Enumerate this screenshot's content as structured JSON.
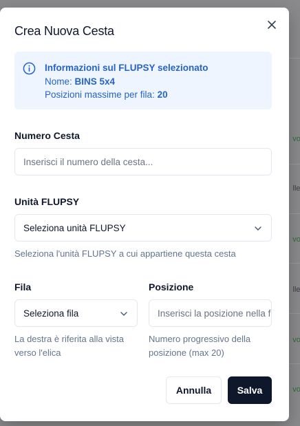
{
  "modal": {
    "title": "Crea Nuova Cesta"
  },
  "info": {
    "heading": "Informazioni sul FLUPSY selezionato",
    "name_label": "Nome: ",
    "name_value": "BINS 5x4",
    "max_label": "Posizioni massime per fila: ",
    "max_value": "20"
  },
  "form": {
    "numero_cesta": {
      "label": "Numero Cesta",
      "placeholder": "Inserisci il numero della cesta...",
      "value": ""
    },
    "unita_flupsy": {
      "label": "Unità FLUPSY",
      "selected": "Seleziona unità FLUPSY",
      "help": "Seleziona l'unità FLUPSY a cui appartiene questa cesta"
    },
    "fila": {
      "label": "Fila",
      "selected": "Seleziona fila",
      "help": "La destra è riferita alla vista verso l'elica"
    },
    "posizione": {
      "label": "Posizione",
      "placeholder": "Inserisci la posizione nella fila",
      "value": "",
      "help": "Numero progressivo della posizione (max 20)"
    }
  },
  "actions": {
    "cancel": "Annulla",
    "save": "Salva"
  },
  "background": {
    "peek_labels": [
      "vo",
      "lle",
      "vo",
      "lle",
      "vo",
      "vo"
    ]
  },
  "icons": {
    "close": "close-icon",
    "info": "info-icon",
    "chevron": "chevron-down-icon"
  },
  "colors": {
    "primary": "#0f172a",
    "info_bg": "#eef5fe",
    "info_text": "#2563c9",
    "muted": "#64748b"
  }
}
